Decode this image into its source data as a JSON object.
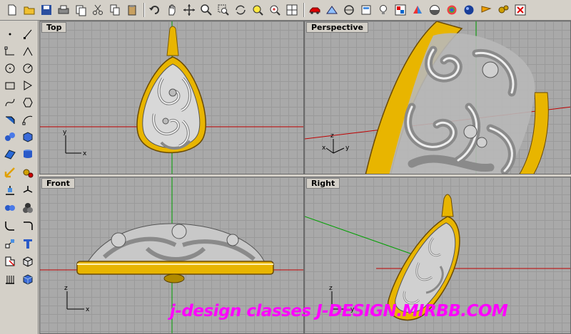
{
  "viewports": {
    "top": {
      "title": "Top",
      "axes": {
        "x": "x",
        "y": "y"
      }
    },
    "perspective": {
      "title": "Perspective",
      "axes": {
        "x": "x",
        "y": "y",
        "z": "z"
      }
    },
    "front": {
      "title": "Front",
      "axes": {
        "x": "x",
        "z": "z"
      }
    },
    "right": {
      "title": "Right",
      "axes": {
        "y": "y",
        "z": "z"
      }
    }
  },
  "watermark": "j-design classes  J-DESIGN.MIRBB.COM",
  "colors": {
    "gold": "#e8b500",
    "silver": "#c8c8c8",
    "grid": "#9a9a9a",
    "viewport_bg": "#a9a9a9",
    "axis_red": "#c00000",
    "axis_green": "#00a000",
    "watermark": "#ff00ff"
  },
  "toolbar_icons": [
    "new-file-icon",
    "open-folder-icon",
    "save-icon",
    "print-icon",
    "copy-page-icon",
    "cut-icon",
    "copy-icon",
    "paste-icon",
    "undo-icon",
    "pan-hand-icon",
    "move-icon",
    "zoom-icon",
    "zoom-window-icon",
    "rotate-view-icon",
    "zoom-extents-icon",
    "zoom-selected-icon",
    "four-viewports-icon",
    "car-icon",
    "toggle-grid-icon",
    "circle-plane-icon",
    "layer-icon",
    "light-bulb-icon",
    "properties-icon",
    "render-icon",
    "shaded-sphere-icon",
    "render-sphere-icon",
    "blue-sphere-icon",
    "flag-icon",
    "gears-icon",
    "close-x-icon"
  ],
  "left_icons": [
    "point-icon",
    "multi-point-icon",
    "line-icon",
    "polyline-icon",
    "circle-icon",
    "arc-icon",
    "rectangle-icon",
    "polygon-icon",
    "curve-icon",
    "control-point-icon",
    "curve-edit-icon",
    "ellipse-icon",
    "sphere-group-icon",
    "box-icon",
    "surface-icon",
    "extrude-icon",
    "transform-icon",
    "settings-gear-icon",
    "align-icon",
    "split-icon",
    "boolean-union-icon",
    "boolean-diff-icon",
    "fillet-icon",
    "dimension-icon",
    "mesh-icon",
    "text-icon",
    "solid-edit-icon",
    "render-box-icon",
    "array-icon",
    "cube-icon"
  ]
}
